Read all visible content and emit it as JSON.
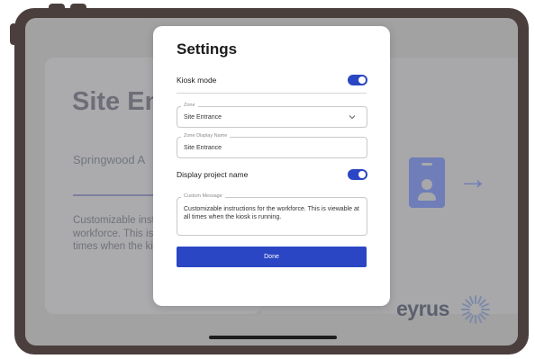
{
  "background": {
    "title": "Site Entrance",
    "subtitle": "Springwood A",
    "instructions": "Customizable instructions for the workforce. This is viewable at all times when the kiosk is running.",
    "dot_text": ".",
    "brand": "eyrus",
    "arrow_glyph": "→",
    "badge_icon": "id-badge-icon",
    "accent_color": "#6f7db8"
  },
  "modal": {
    "title": "Settings",
    "kiosk_mode": {
      "label": "Kiosk mode",
      "enabled": true
    },
    "zone": {
      "label": "Zone",
      "value": "Site Entrance"
    },
    "zone_display_name": {
      "label": "Zone Display Name",
      "value": "Site Entrance"
    },
    "display_project_name": {
      "label": "Display project name",
      "enabled": true
    },
    "custom_message": {
      "label": "Custom Message",
      "value": "Customizable instructions for the workforce. This is viewable at all times when the kiosk is running."
    },
    "done_label": "Done",
    "accent_color": "#2b46c4"
  }
}
